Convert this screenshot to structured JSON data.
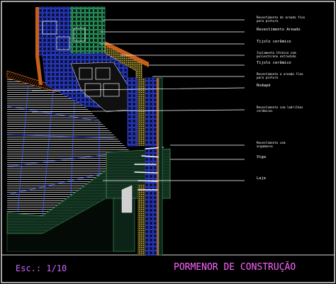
{
  "drawing": {
    "title": "PORMENOR DE CONSTRUÇÃO",
    "scale": "Esc.: 1/10",
    "colors": {
      "background": "#000000",
      "frame": "#d9d9d9",
      "leader_line": "#ffffff",
      "brick_blue": "#2a3fd0",
      "brick_green": "#2fa06a",
      "insulation": "#d8c24a",
      "render_orange": "#c8601a",
      "tile_white": "#cfcfcf",
      "concrete_green": "#2c6a3a",
      "title_magenta": "#ff66ff"
    },
    "labels": [
      {
        "name": "render-outer-label",
        "lines": [
          "Revestimento de areado fino",
          "para pintura"
        ],
        "size": "tiny"
      },
      {
        "name": "render-sanded-label",
        "lines": [
          "Revestimento Areado"
        ],
        "size": "small"
      },
      {
        "name": "ceramic-brick-outer-label",
        "lines": [
          "Tijolo cerâmico"
        ],
        "size": "small"
      },
      {
        "name": "insulation-label",
        "lines": [
          "Isolamento térmico com",
          "poliestireno extrudido"
        ],
        "size": "tiny"
      },
      {
        "name": "ceramic-brick-inner-label",
        "lines": [
          "Tijolo cerâmico"
        ],
        "size": "small"
      },
      {
        "name": "render-inner-label",
        "lines": [
          "Revestimento a areado fino",
          "para pintura"
        ],
        "size": "tiny"
      },
      {
        "name": "skirting-label",
        "lines": [
          "Rodapé"
        ],
        "size": "small"
      },
      {
        "name": "floor-tile-label",
        "lines": [
          "Revestimento com ladrilhos",
          "cerâmicos"
        ],
        "size": "tiny"
      },
      {
        "name": "mortar-label",
        "lines": [
          "Revestimento com",
          "argamassa"
        ],
        "size": "tiny"
      },
      {
        "name": "beam-label",
        "lines": [
          "Viga"
        ],
        "size": "small"
      },
      {
        "name": "slab-label",
        "lines": [
          "Laje"
        ],
        "size": "small"
      }
    ]
  }
}
